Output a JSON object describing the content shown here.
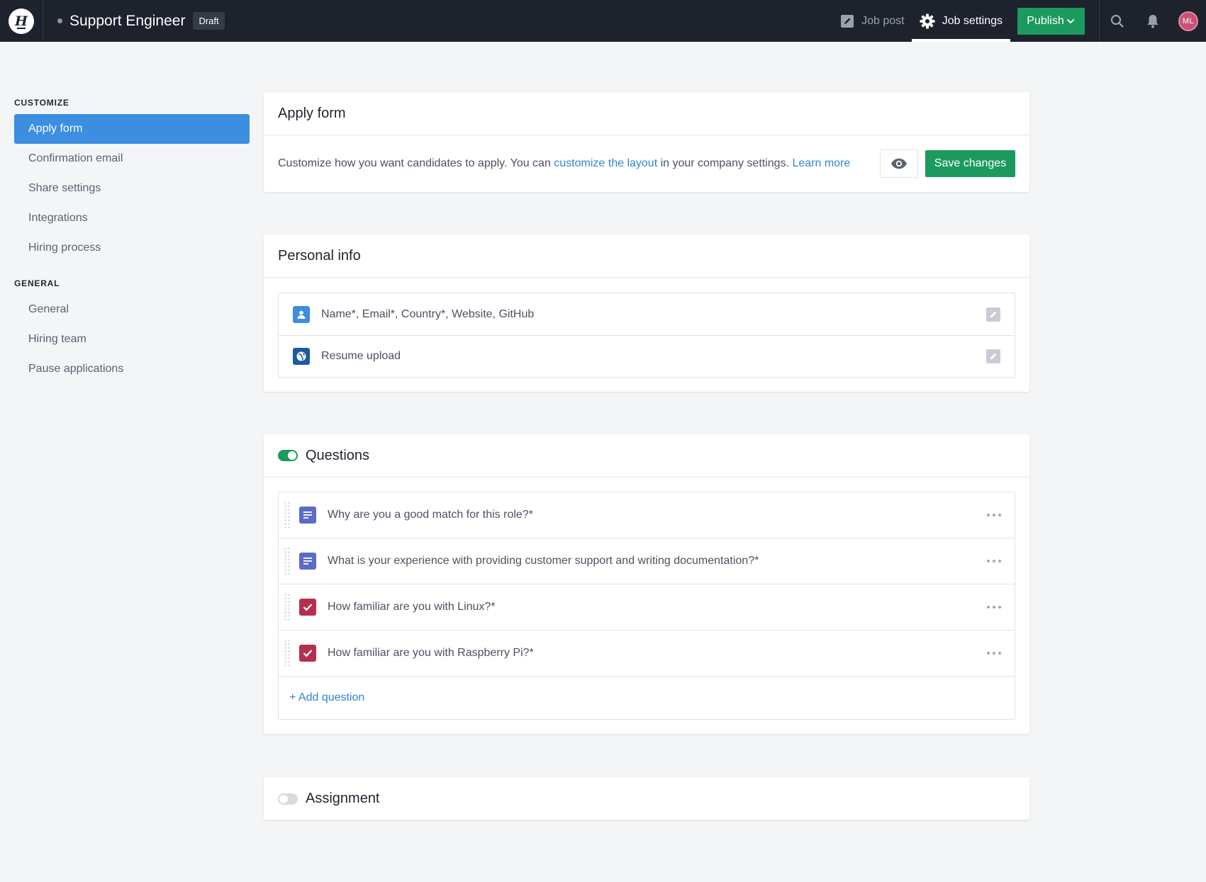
{
  "topbar": {
    "logo_letter": "H",
    "job_title": "Support Engineer",
    "status_badge": "Draft",
    "nav": {
      "job_post": "Job post",
      "job_settings": "Job settings",
      "publish": "Publish"
    },
    "avatar_initials": "ML"
  },
  "sidebar": {
    "customize_heading": "CUSTOMIZE",
    "customize_items": [
      {
        "label": "Apply form",
        "active": true
      },
      {
        "label": "Confirmation email"
      },
      {
        "label": "Share settings"
      },
      {
        "label": "Integrations"
      },
      {
        "label": "Hiring process"
      }
    ],
    "general_heading": "GENERAL",
    "general_items": [
      {
        "label": "General"
      },
      {
        "label": "Hiring team"
      },
      {
        "label": "Pause applications"
      }
    ]
  },
  "apply_form": {
    "title": "Apply form",
    "desc_before": "Customize how you want candidates to apply. You can ",
    "desc_link": "customize the layout",
    "desc_after": " in your company settings. ",
    "learn_more": "Learn more",
    "save": "Save changes"
  },
  "personal_info": {
    "title": "Personal info",
    "fields": [
      {
        "text": "Name*, Email*, Country*, Website, GitHub",
        "icon": "person-icon"
      },
      {
        "text": "Resume upload",
        "icon": "globe-icon"
      }
    ]
  },
  "questions": {
    "title": "Questions",
    "enabled": true,
    "items": [
      {
        "text": "Why are you a good match for this role?*",
        "type": "text",
        "icon": "paragraph-icon"
      },
      {
        "text": "What is your experience with providing customer support and writing documentation?*",
        "type": "text",
        "icon": "paragraph-icon"
      },
      {
        "text": "How familiar are you with Linux?*",
        "type": "checkbox",
        "icon": "checkbox-icon"
      },
      {
        "text": "How familiar are you with Raspberry Pi?*",
        "type": "checkbox",
        "icon": "checkbox-icon"
      }
    ],
    "add_label": "+ Add question"
  },
  "assignment": {
    "title": "Assignment",
    "enabled": false
  },
  "colors": {
    "topbar_bg": "#1d222c",
    "accent_green": "#1c9a5d",
    "accent_blue": "#3b8ee0",
    "link_blue": "#2f86d4",
    "text_question_icon": "#5c6bc8",
    "checkbox_question_icon": "#b5304f"
  }
}
